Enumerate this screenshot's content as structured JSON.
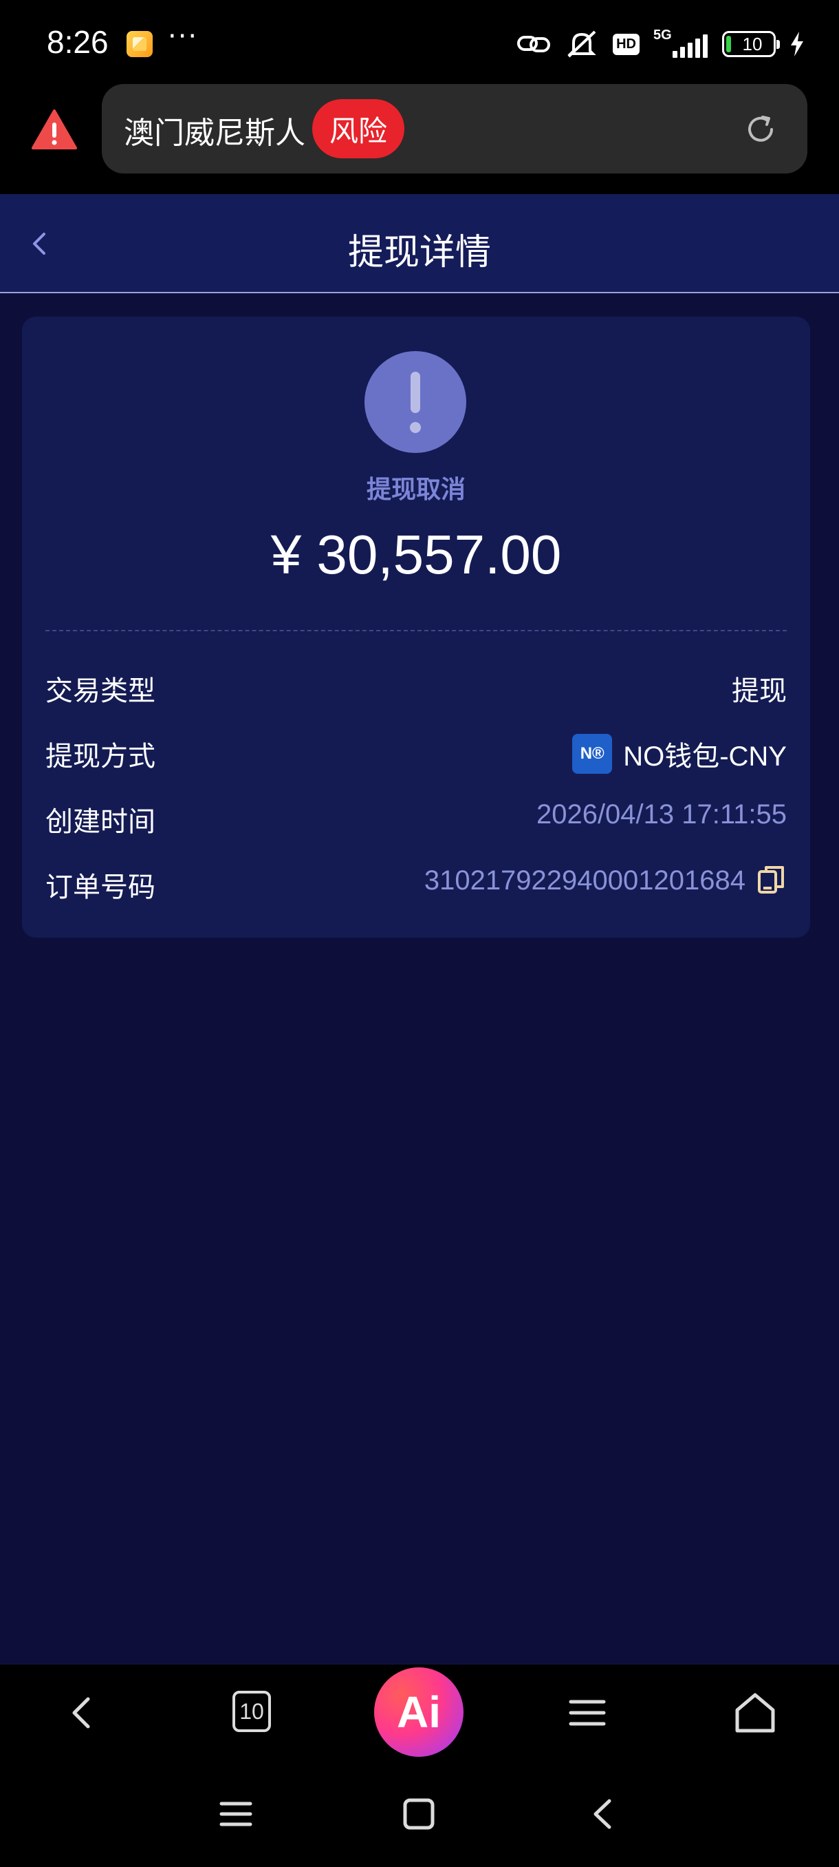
{
  "status_bar": {
    "time": "8:26",
    "dots": "···",
    "network": "5G",
    "hd": "HD",
    "battery": "10"
  },
  "browser": {
    "url_text": "澳门威尼斯人",
    "risk_label": "风险"
  },
  "header": {
    "title": "提现详情"
  },
  "detail": {
    "status": "提现取消",
    "amount": "¥ 30,557.00",
    "rows": [
      {
        "label": "交易类型",
        "value": "提现"
      },
      {
        "label": "提现方式",
        "value": "NO钱包-CNY",
        "logo": "N®"
      },
      {
        "label": "创建时间",
        "value": "2026/04/13 17:11:55"
      },
      {
        "label": "订单号码",
        "value": "3102179229400012016​84"
      }
    ]
  },
  "bottom_nav": {
    "tab_count": "10",
    "ai_label": "Ai"
  },
  "colors": {
    "background": "#0d0f3a",
    "card": "#141b53",
    "header": "#151c5a",
    "status_accent": "#7c85d6",
    "risk_red": "#e8232b",
    "muted_value": "#8a92d8",
    "copy_icon": "#f0d7a8"
  },
  "icons": {
    "warning": "warning-triangle-icon",
    "reload": "reload-icon",
    "back": "chevron-left-icon",
    "status": "exclamation-icon",
    "copy": "copy-icon"
  }
}
